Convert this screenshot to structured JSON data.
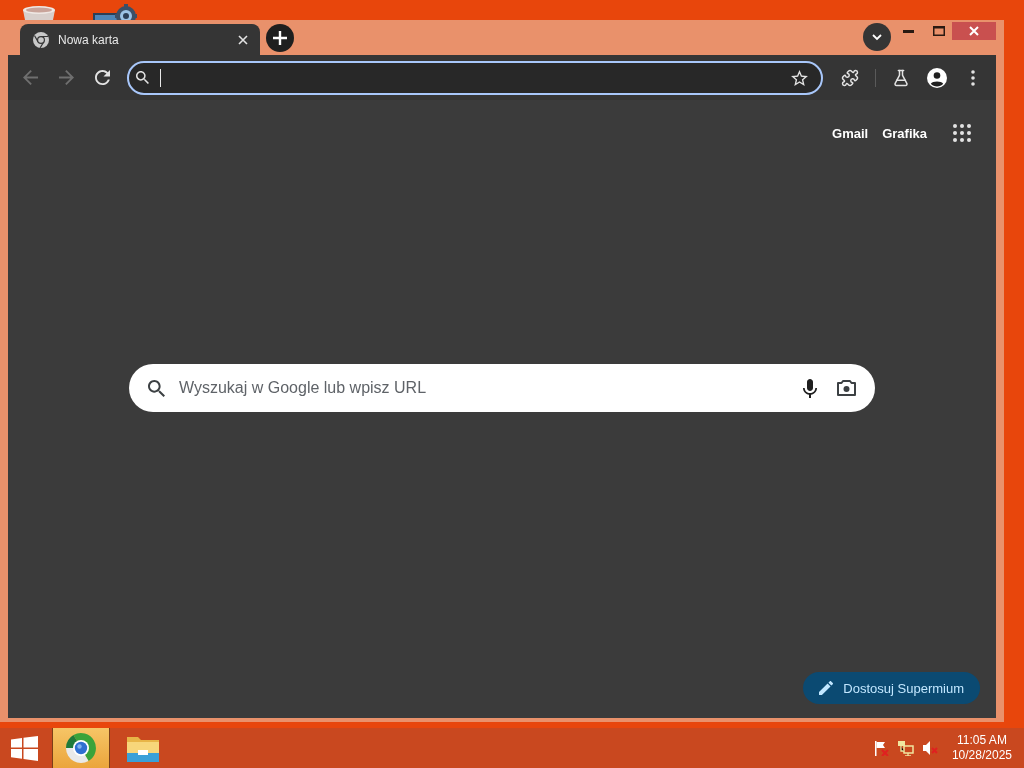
{
  "window": {
    "tabs": [
      {
        "title": "Nowa karta",
        "selected": true
      }
    ]
  },
  "toolbar": {
    "buttons": [
      {
        "kind": "back",
        "disabled": true
      },
      {
        "kind": "forward",
        "disabled": true
      },
      {
        "kind": "reload",
        "disabled": false
      }
    ],
    "omnibox": {
      "focused": true
    }
  },
  "page": {
    "header_links": [
      "Gmail",
      "Grafika"
    ],
    "search": {
      "placeholder": "Wyszukaj w Google lub wpisz URL"
    },
    "customize_button": {
      "label": "Dostosuj Supermium"
    }
  },
  "taskbar": {
    "apps": [
      {
        "kind": "browser",
        "selected": true
      },
      {
        "kind": "explorer",
        "selected": false
      }
    ],
    "clock": {
      "time": "11:05 AM",
      "date": "10/28/2025"
    }
  }
}
